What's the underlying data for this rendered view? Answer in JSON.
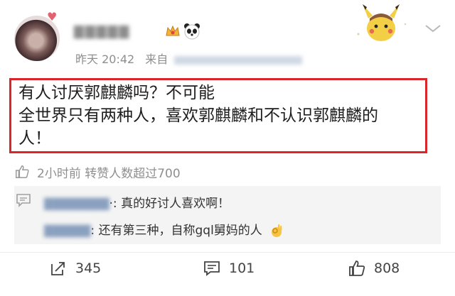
{
  "post": {
    "time": "昨天 20:42",
    "source_prefix": "来自",
    "body_lines": [
      "有人讨厌郭麒麟吗？不可能",
      "全世界只有两种人，喜欢郭麒麟和不认识郭麒麟的",
      "人！"
    ],
    "stats_text": "2小时前 转赞人数超过700"
  },
  "comments": [
    {
      "text": "·: 真的好讨人喜欢啊！"
    },
    {
      "text": ": 还有第三种，自称gql舅妈的人"
    }
  ],
  "actions": {
    "repost_count": "345",
    "comment_count": "101",
    "like_count": "808"
  },
  "colors": {
    "highlight_border": "#d8262a",
    "muted_text": "#8e8e8e",
    "comment_bg": "#f4f4f4"
  },
  "icons": [
    "heart-icon",
    "crown-badge-icon",
    "panda-badge-icon",
    "chevron-down-icon",
    "thumbs-up-icon",
    "comment-icon",
    "ok-hand-icon",
    "repost-icon",
    "like-icon"
  ]
}
